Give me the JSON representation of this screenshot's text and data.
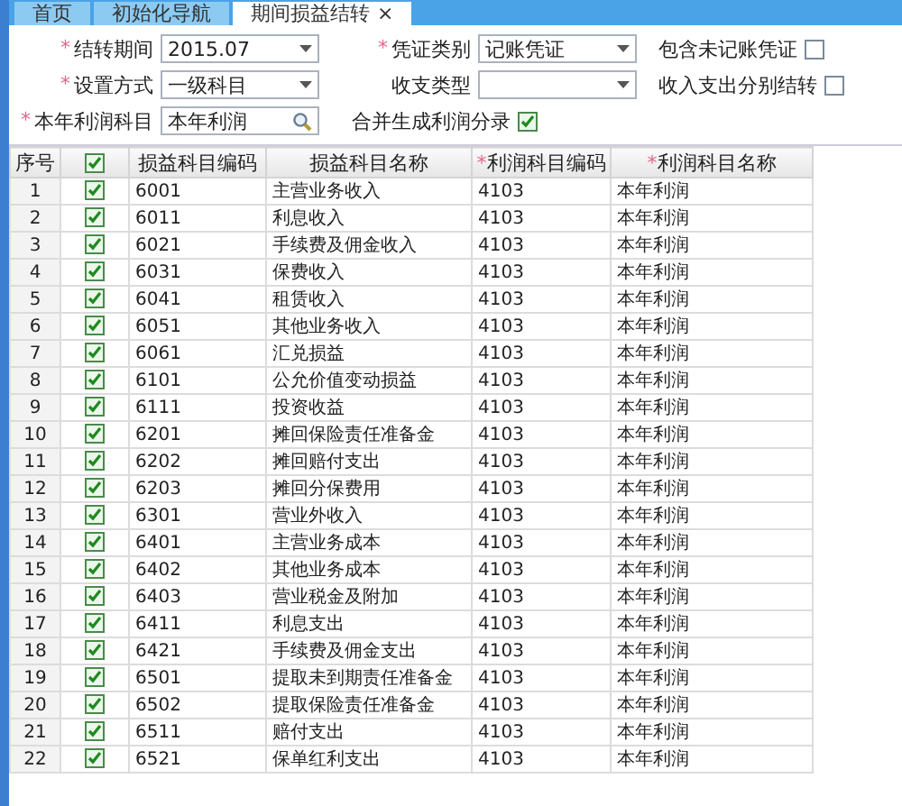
{
  "tabs": [
    {
      "label": "首页",
      "selected": false
    },
    {
      "label": "初始化导航",
      "selected": false
    },
    {
      "label": "期间损益结转",
      "selected": true,
      "close": "×"
    }
  ],
  "form": {
    "rows": [
      [
        {
          "kind": "select",
          "label": "结转期间",
          "mark": "*",
          "value": "2015.07"
        },
        {
          "kind": "select",
          "label": "凭证类别",
          "mark": "*",
          "value": "记账凭证"
        },
        {
          "kind": "checkbox",
          "label": "包含未记账凭证",
          "checked": false
        }
      ],
      [
        {
          "kind": "select",
          "label": "设置方式",
          "mark": "*",
          "value": "一级科目"
        },
        {
          "kind": "select",
          "label": "收支类型"
        },
        {
          "kind": "checkbox",
          "label": "收入支出分别结转",
          "checked": false
        }
      ],
      [
        {
          "kind": "lookup",
          "label": "本年利润科目",
          "mark": "*",
          "value": "本年利润"
        },
        {
          "kind": "checkbox",
          "label": "合并生成利润分录",
          "checked": true
        }
      ]
    ]
  },
  "table": {
    "columns": [
      {
        "kind": "text",
        "label": "序号"
      },
      {
        "kind": "checkbox",
        "checked": true
      },
      {
        "kind": "text",
        "label": "损益科目编码"
      },
      {
        "kind": "text",
        "label": "损益科目名称"
      },
      {
        "kind": "text",
        "label": "利润科目编码",
        "mark": "*"
      },
      {
        "kind": "text",
        "label": "利润科目名称",
        "mark": "*"
      }
    ],
    "rows": [
      {
        "no": "1",
        "checked": true,
        "code": "6001",
        "name": "主营业务收入",
        "profit_code": "4103",
        "profit_name": "本年利润"
      },
      {
        "no": "2",
        "checked": true,
        "code": "6011",
        "name": "利息收入",
        "profit_code": "4103",
        "profit_name": "本年利润"
      },
      {
        "no": "3",
        "checked": true,
        "code": "6021",
        "name": "手续费及佣金收入",
        "profit_code": "4103",
        "profit_name": "本年利润"
      },
      {
        "no": "4",
        "checked": true,
        "code": "6031",
        "name": "保费收入",
        "profit_code": "4103",
        "profit_name": "本年利润"
      },
      {
        "no": "5",
        "checked": true,
        "code": "6041",
        "name": "租赁收入",
        "profit_code": "4103",
        "profit_name": "本年利润"
      },
      {
        "no": "6",
        "checked": true,
        "code": "6051",
        "name": "其他业务收入",
        "profit_code": "4103",
        "profit_name": "本年利润"
      },
      {
        "no": "7",
        "checked": true,
        "code": "6061",
        "name": "汇兑损益",
        "profit_code": "4103",
        "profit_name": "本年利润"
      },
      {
        "no": "8",
        "checked": true,
        "code": "6101",
        "name": "公允价值变动损益",
        "profit_code": "4103",
        "profit_name": "本年利润"
      },
      {
        "no": "9",
        "checked": true,
        "code": "6111",
        "name": "投资收益",
        "profit_code": "4103",
        "profit_name": "本年利润"
      },
      {
        "no": "10",
        "checked": true,
        "code": "6201",
        "name": "摊回保险责任准备金",
        "profit_code": "4103",
        "profit_name": "本年利润"
      },
      {
        "no": "11",
        "checked": true,
        "code": "6202",
        "name": "摊回赔付支出",
        "profit_code": "4103",
        "profit_name": "本年利润"
      },
      {
        "no": "12",
        "checked": true,
        "code": "6203",
        "name": "摊回分保费用",
        "profit_code": "4103",
        "profit_name": "本年利润"
      },
      {
        "no": "13",
        "checked": true,
        "code": "6301",
        "name": "营业外收入",
        "profit_code": "4103",
        "profit_name": "本年利润"
      },
      {
        "no": "14",
        "checked": true,
        "code": "6401",
        "name": "主营业务成本",
        "profit_code": "4103",
        "profit_name": "本年利润"
      },
      {
        "no": "15",
        "checked": true,
        "code": "6402",
        "name": "其他业务成本",
        "profit_code": "4103",
        "profit_name": "本年利润"
      },
      {
        "no": "16",
        "checked": true,
        "code": "6403",
        "name": "营业税金及附加",
        "profit_code": "4103",
        "profit_name": "本年利润"
      },
      {
        "no": "17",
        "checked": true,
        "code": "6411",
        "name": "利息支出",
        "profit_code": "4103",
        "profit_name": "本年利润"
      },
      {
        "no": "18",
        "checked": true,
        "code": "6421",
        "name": "手续费及佣金支出",
        "profit_code": "4103",
        "profit_name": "本年利润"
      },
      {
        "no": "19",
        "checked": true,
        "code": "6501",
        "name": "提取未到期责任准备金",
        "profit_code": "4103",
        "profit_name": "本年利润"
      },
      {
        "no": "20",
        "checked": true,
        "code": "6502",
        "name": "提取保险责任准备金",
        "profit_code": "4103",
        "profit_name": "本年利润"
      },
      {
        "no": "21",
        "checked": true,
        "code": "6511",
        "name": "赔付支出",
        "profit_code": "4103",
        "profit_name": "本年利润"
      },
      {
        "no": "22",
        "checked": true,
        "code": "6521",
        "name": "保单红利支出",
        "profit_code": "4103",
        "profit_name": "本年利润"
      }
    ]
  }
}
